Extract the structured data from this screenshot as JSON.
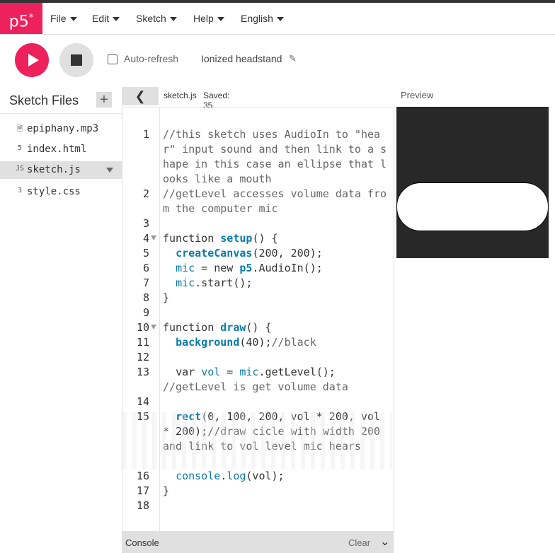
{
  "app": {
    "logo": "p5",
    "logo_sup": "*"
  },
  "menu": [
    {
      "label": "File"
    },
    {
      "label": "Edit"
    },
    {
      "label": "Sketch"
    },
    {
      "label": "Help"
    },
    {
      "label": "English"
    }
  ],
  "toolbar": {
    "play_icon": "play-icon",
    "stop_icon": "stop-icon",
    "auto_refresh_label": "Auto-refresh",
    "auto_refresh_checked": false,
    "project_name": "Ionized headstand",
    "edit_icon": "pencil-icon"
  },
  "sidebar": {
    "title": "Sketch Files",
    "add_label": "+",
    "files": [
      {
        "name": "epiphany.mp3",
        "icon": "file-icon",
        "glyph": "🗎"
      },
      {
        "name": "index.html",
        "icon": "html-icon",
        "glyph": "5"
      },
      {
        "name": "sketch.js",
        "icon": "js-icon",
        "glyph": "JS",
        "selected": true
      },
      {
        "name": "style.css",
        "icon": "css-icon",
        "glyph": "3"
      }
    ]
  },
  "editor": {
    "back_label": "❮",
    "tab_name": "sketch.js",
    "saved_status": "Saved: 35"
  },
  "code": {
    "l1": "//this sketch uses AudioIn to \"hear\" input sound and then link to a shape in this case an ellipse that looks like a mouth",
    "l2": "//getLevel accesses volume data from the computer mic",
    "l4a": "function ",
    "l4b": "setup",
    "l4c": "() {",
    "l5a": "createCanvas",
    "l5b": "(200, 200);",
    "l6a": "mic",
    "l6b": " = new ",
    "l6c": "p5",
    "l6d": ".AudioIn();",
    "l7a": "mic",
    "l7b": ".start();",
    "l8": "}",
    "l10a": "function ",
    "l10b": "draw",
    "l10c": "() {",
    "l11a": "background",
    "l11b": "(40);",
    "l11c": "//black",
    "l13a": "var ",
    "l13b": "vol",
    "l13c": " = ",
    "l13d": "mic",
    "l13e": ".getLevel();",
    "l13f": "//getLevel is get volume data",
    "l15a": "rect",
    "l15b": "(0, 100, 200, vol * 200, vol * 200);",
    "l15c": "//draw cicle with width 200 and link to vol level mic hears",
    "l16a": "console",
    "l16b": ".",
    "l16c": "log",
    "l16d": "(vol);",
    "l17": "}"
  },
  "line_numbers": [
    "1",
    "2",
    "3",
    "4",
    "5",
    "6",
    "7",
    "8",
    "9",
    "10",
    "11",
    "12",
    "13",
    "14",
    "15",
    "16",
    "17",
    "18"
  ],
  "console": {
    "label": "Console",
    "clear_label": "Clear",
    "chevron": "⌄"
  },
  "preview": {
    "label": "Preview",
    "background": "#282828",
    "shape_fill": "#ffffff"
  },
  "colors": {
    "accent": "#ed225d",
    "code_function": "#0b7ca9"
  }
}
